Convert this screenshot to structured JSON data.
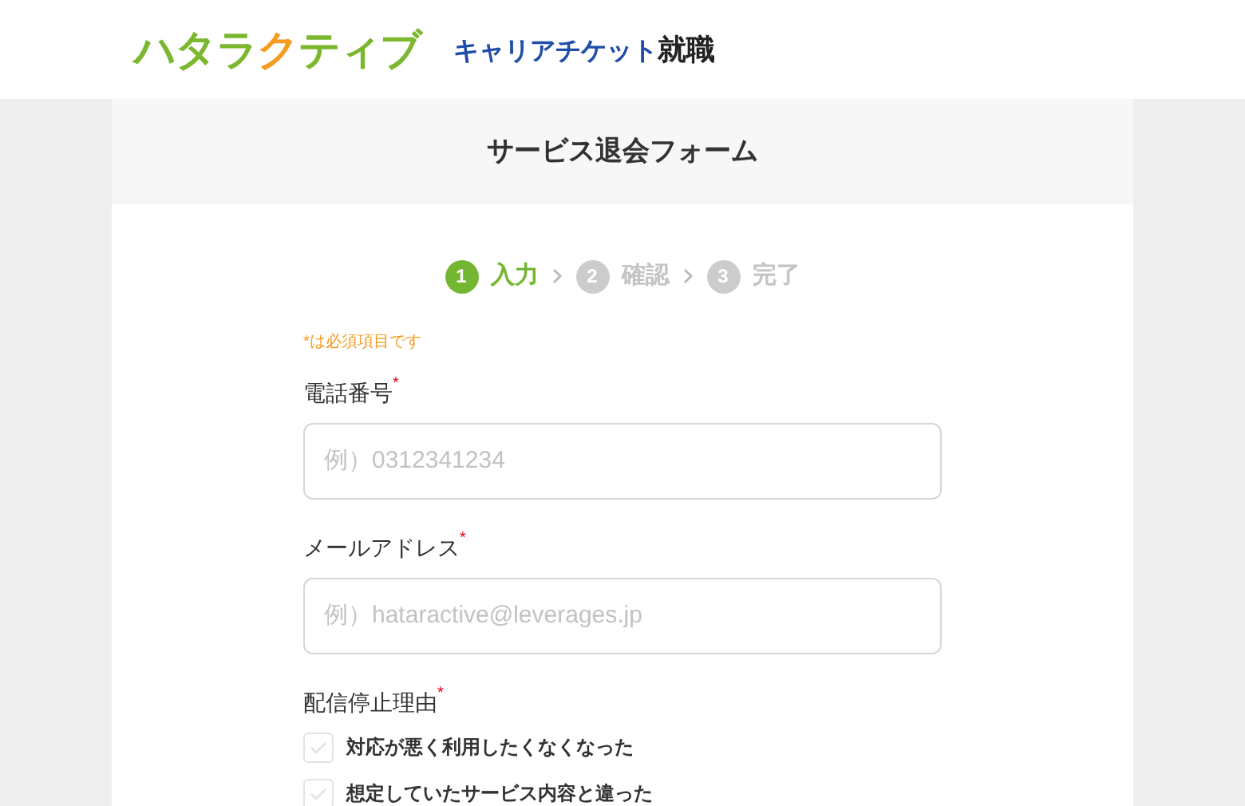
{
  "header": {
    "logo": [
      {
        "text": "ハタラ",
        "color": "#7cb82f"
      },
      {
        "text": "ク",
        "color": "#f39c1e"
      },
      {
        "text": "ティブ",
        "color": "#7cb82f"
      }
    ],
    "brand": "キャリアチケット",
    "brand_suffix": "就職"
  },
  "form_title": "サービス退会フォーム",
  "steps": [
    {
      "number": "1",
      "label": "入力",
      "selected": true
    },
    {
      "number": "2",
      "label": "確認",
      "selected": false
    },
    {
      "number": "3",
      "label": "完了",
      "selected": false
    }
  ],
  "required_note": "*は必須項目です",
  "fields": [
    {
      "label": "電話番号",
      "required_mark": "*",
      "placeholder": "例）0312341234"
    },
    {
      "label": "メールアドレス",
      "required_mark": "*",
      "placeholder": "例）hataractive@leverages.jp"
    }
  ],
  "reasons": {
    "label": "配信停止理由",
    "required_mark": "*",
    "options": [
      {
        "label": "対応が悪く利用したくなくなった",
        "checked": false
      },
      {
        "label": "想定していたサービス内容と違った",
        "checked": false
      }
    ]
  }
}
